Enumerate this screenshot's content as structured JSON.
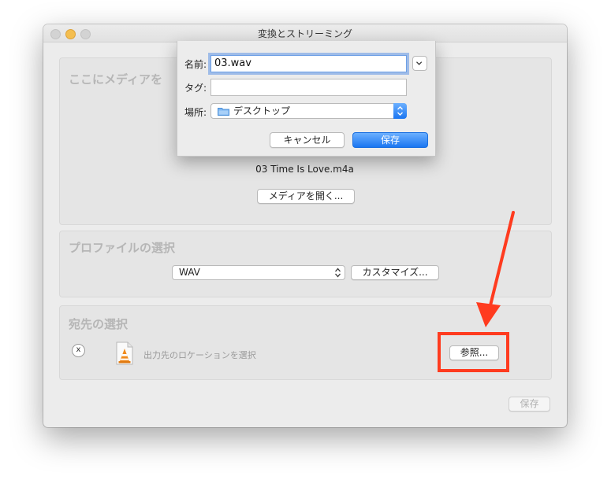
{
  "window": {
    "title": "変換とストリーミング"
  },
  "source_panel": {
    "title": "ここにメディアを",
    "filename": "03 Time Is Love.m4a",
    "open_media_label": "メディアを開く..."
  },
  "profile_panel": {
    "title": "プロファイルの選択",
    "selected_profile": "WAV",
    "customize_label": "カスタマイズ..."
  },
  "destination_panel": {
    "title": "宛先の選択",
    "clear_label": "x",
    "location_placeholder": "出力先のロケーションを選択",
    "browse_label": "参照..."
  },
  "footer": {
    "save_label": "保存"
  },
  "save_sheet": {
    "name_label": "名前:",
    "name_value": "03.wav",
    "tags_label": "タグ:",
    "tags_value": "",
    "where_label": "場所:",
    "where_value": "デスクトップ",
    "cancel_label": "キャンセル",
    "save_label": "保存"
  },
  "colors": {
    "highlight": "#ff3b1f",
    "accent_blue": "#1b76f1",
    "panel_title_gray": "#b6b6b6"
  },
  "icons": [
    "vlc-cone-icon",
    "folder-icon",
    "chevron-down-icon",
    "updown-arrows-icon",
    "red-arrow-icon"
  ]
}
